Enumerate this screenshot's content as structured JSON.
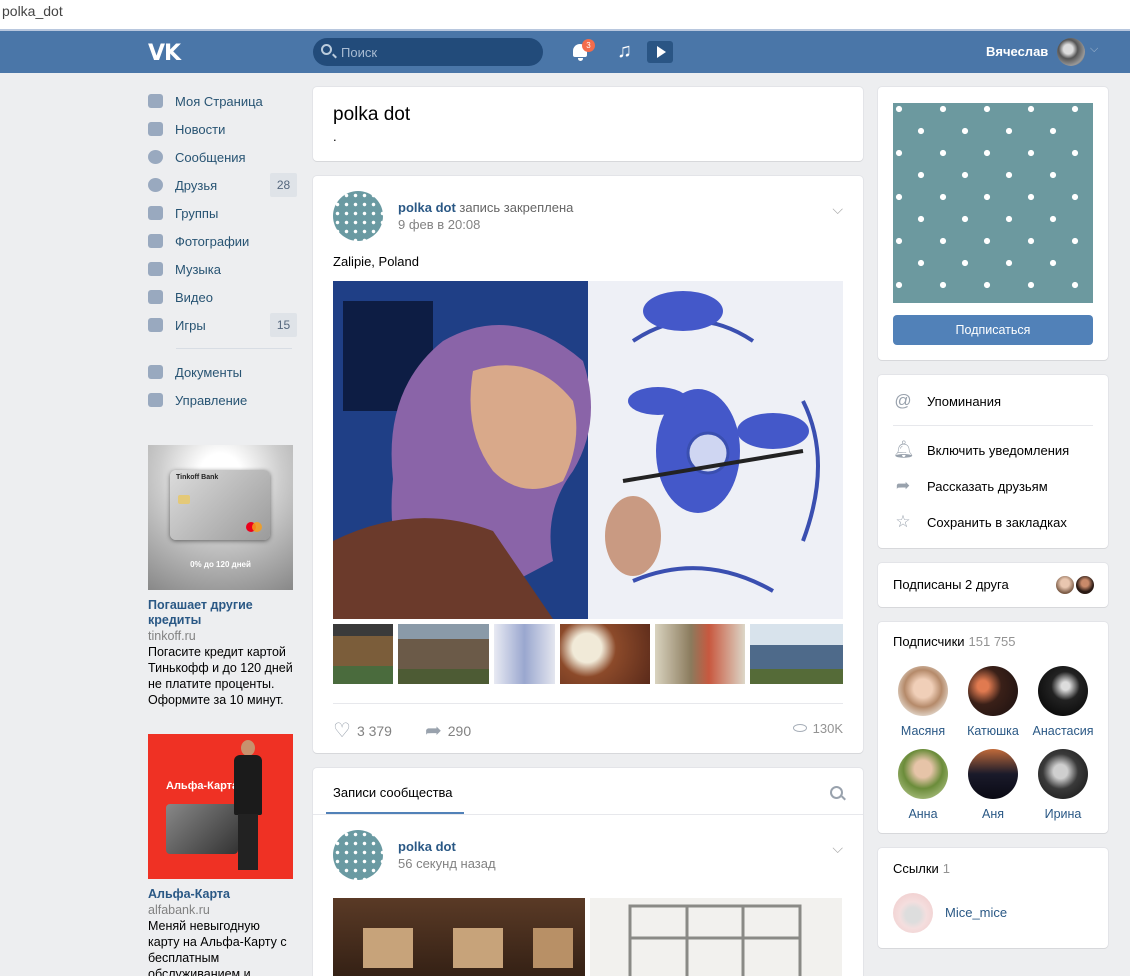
{
  "browser": {
    "url_text": "polka_dot"
  },
  "header": {
    "logo": "VK",
    "search_placeholder": "Поиск",
    "notifications_count": "3",
    "user_name": "Вячеслав"
  },
  "nav": {
    "items": [
      {
        "label": "Моя Страница",
        "icon": "home-icon"
      },
      {
        "label": "Новости",
        "icon": "news-icon"
      },
      {
        "label": "Сообщения",
        "icon": "messages-icon"
      },
      {
        "label": "Друзья",
        "icon": "friends-icon",
        "count": "28"
      },
      {
        "label": "Группы",
        "icon": "groups-icon"
      },
      {
        "label": "Фотографии",
        "icon": "camera-icon"
      },
      {
        "label": "Музыка",
        "icon": "music-icon"
      },
      {
        "label": "Видео",
        "icon": "video-icon"
      },
      {
        "label": "Игры",
        "icon": "gamepad-icon",
        "count": "15"
      }
    ],
    "extra": [
      {
        "label": "Документы",
        "icon": "document-icon"
      },
      {
        "label": "Управление",
        "icon": "gamepad-icon"
      }
    ]
  },
  "ads": [
    {
      "image_card_label": "Tinkoff Bank",
      "image_caption": "0% до 120 дней",
      "title": "Погашает другие кредиты",
      "domain": "tinkoff.ru",
      "text": "Погасите кредит картой Тинькофф и до 120 дней не платите проценты. Оформите за 10 минут."
    },
    {
      "image_caption": "Альфа-Карта",
      "title": "Альфа-Карта",
      "domain": "alfabank.ru",
      "text": "Меняй невыгодную карту на Альфа-Карту с бесплатным обслуживанием и"
    }
  ],
  "group": {
    "title": "polka dot",
    "status": "."
  },
  "pinned_post": {
    "author": "polka dot",
    "pinned_label": "запись закреплена",
    "date": "9 фев в 20:08",
    "text": "Zalipie, Poland",
    "likes": "3 379",
    "shares": "290",
    "views": "130K"
  },
  "wall": {
    "tab_label": "Записи сообщества",
    "post": {
      "author": "polka dot",
      "date": "56 секунд назад"
    }
  },
  "right": {
    "subscribe_label": "Подписаться",
    "actions": [
      {
        "label": "Упоминания",
        "icon": "at-icon"
      },
      {
        "label": "Включить уведомления",
        "icon": "bell-icon"
      },
      {
        "label": "Рассказать друзьям",
        "icon": "share-arrow-icon"
      },
      {
        "label": "Сохранить в закладках",
        "icon": "star-icon"
      }
    ],
    "friends_label": "Подписаны 2 друга",
    "subscribers": {
      "label": "Подписчики",
      "count": "151 755",
      "people": [
        "Масяня",
        "Катюшка",
        "Анастасия",
        "Анна",
        "Аня",
        "Ирина"
      ]
    },
    "links": {
      "label": "Ссылки",
      "count": "1",
      "items": [
        "Mice_mice"
      ]
    }
  },
  "colors": {
    "header": "#4a76a8",
    "accent": "#5181b8",
    "link": "#2a5885",
    "page_bg": "#edeef0"
  }
}
